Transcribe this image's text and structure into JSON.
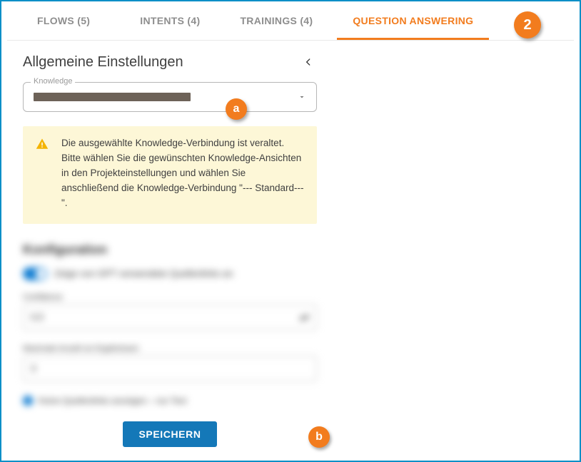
{
  "tabs": {
    "flows": "FLOWS (5)",
    "intents": "INTENTS (4)",
    "trainings": "TRAININGS (4)",
    "qa": "QUESTION ANSWERING"
  },
  "section": {
    "title": "Allgemeine Einstellungen"
  },
  "knowledge": {
    "label": "Knowledge"
  },
  "warning": {
    "text": "Die ausgewählte Knowledge-Verbindung ist veraltet. Bitte wählen Sie die gewünschten Knowledge-Ansichten in den Projekteinstellungen und wählen Sie anschließend die Knowledge-Verbindung \"--- Standard---\"."
  },
  "config": {
    "title": "Konfiguration",
    "switch_label": "Zeige von GPT verwendete Quellenlinks an",
    "conf_label": "Confidence",
    "conf_value": "0,5",
    "max_label": "Maximale Anzahl an Ergebnissen",
    "max_value": "3",
    "radio_label": "Keine Quellenlinks anzeigen – nur Text"
  },
  "actions": {
    "save": "SPEICHERN"
  },
  "annotations": {
    "step": "2",
    "a": "a",
    "b": "b"
  }
}
